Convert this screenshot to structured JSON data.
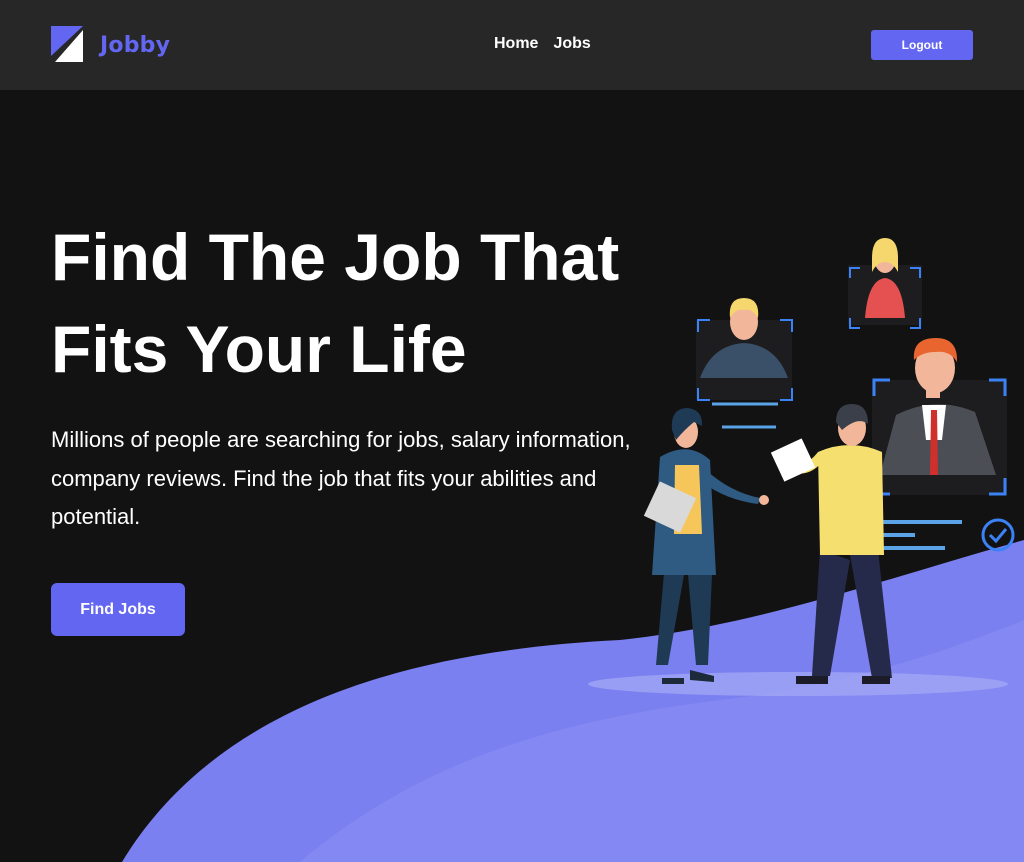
{
  "header": {
    "logo_text": "Jobby",
    "nav": [
      {
        "label": "Home"
      },
      {
        "label": "Jobs"
      }
    ],
    "logout_label": "Logout"
  },
  "hero": {
    "title_line1": "Find The Job That",
    "title_line2": "Fits Your Life",
    "description": "Millions of people are searching for jobs, salary information, company reviews. Find the job that fits your abilities and potential.",
    "cta_label": "Find Jobs"
  },
  "theme": {
    "accent": "#6366f1",
    "navbar_bg": "#272727",
    "page_bg": "#121212",
    "wave": "#7b80f0"
  },
  "icons": [
    "logo-icon",
    "check-circle-icon"
  ]
}
